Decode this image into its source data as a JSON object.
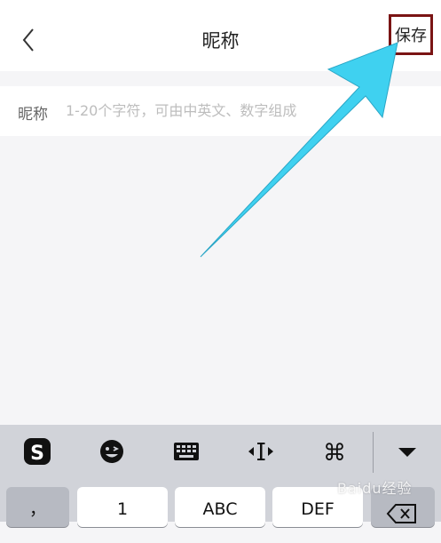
{
  "header": {
    "back_icon": "chevron-left-icon",
    "title": "昵称",
    "save_label": "保存"
  },
  "form": {
    "nickname_label": "昵称",
    "nickname_placeholder": "1-20个字符，可由中英文、数字组成",
    "nickname_value": ""
  },
  "keyboard": {
    "toolbar_icons": [
      "sogou-logo-icon",
      "emoji-icon",
      "keyboard-icon",
      "cursor-move-icon",
      "command-icon",
      "collapse-icon"
    ],
    "keys": {
      "comma": "，",
      "key1": "1",
      "key2": "ABC",
      "key3": "DEF"
    },
    "delete_icon": "backspace-icon"
  },
  "watermark": {
    "text": "Baidu经验"
  },
  "colors": {
    "annotation_arrow": "#3fd1f0",
    "annotation_box": "#7a1414"
  }
}
